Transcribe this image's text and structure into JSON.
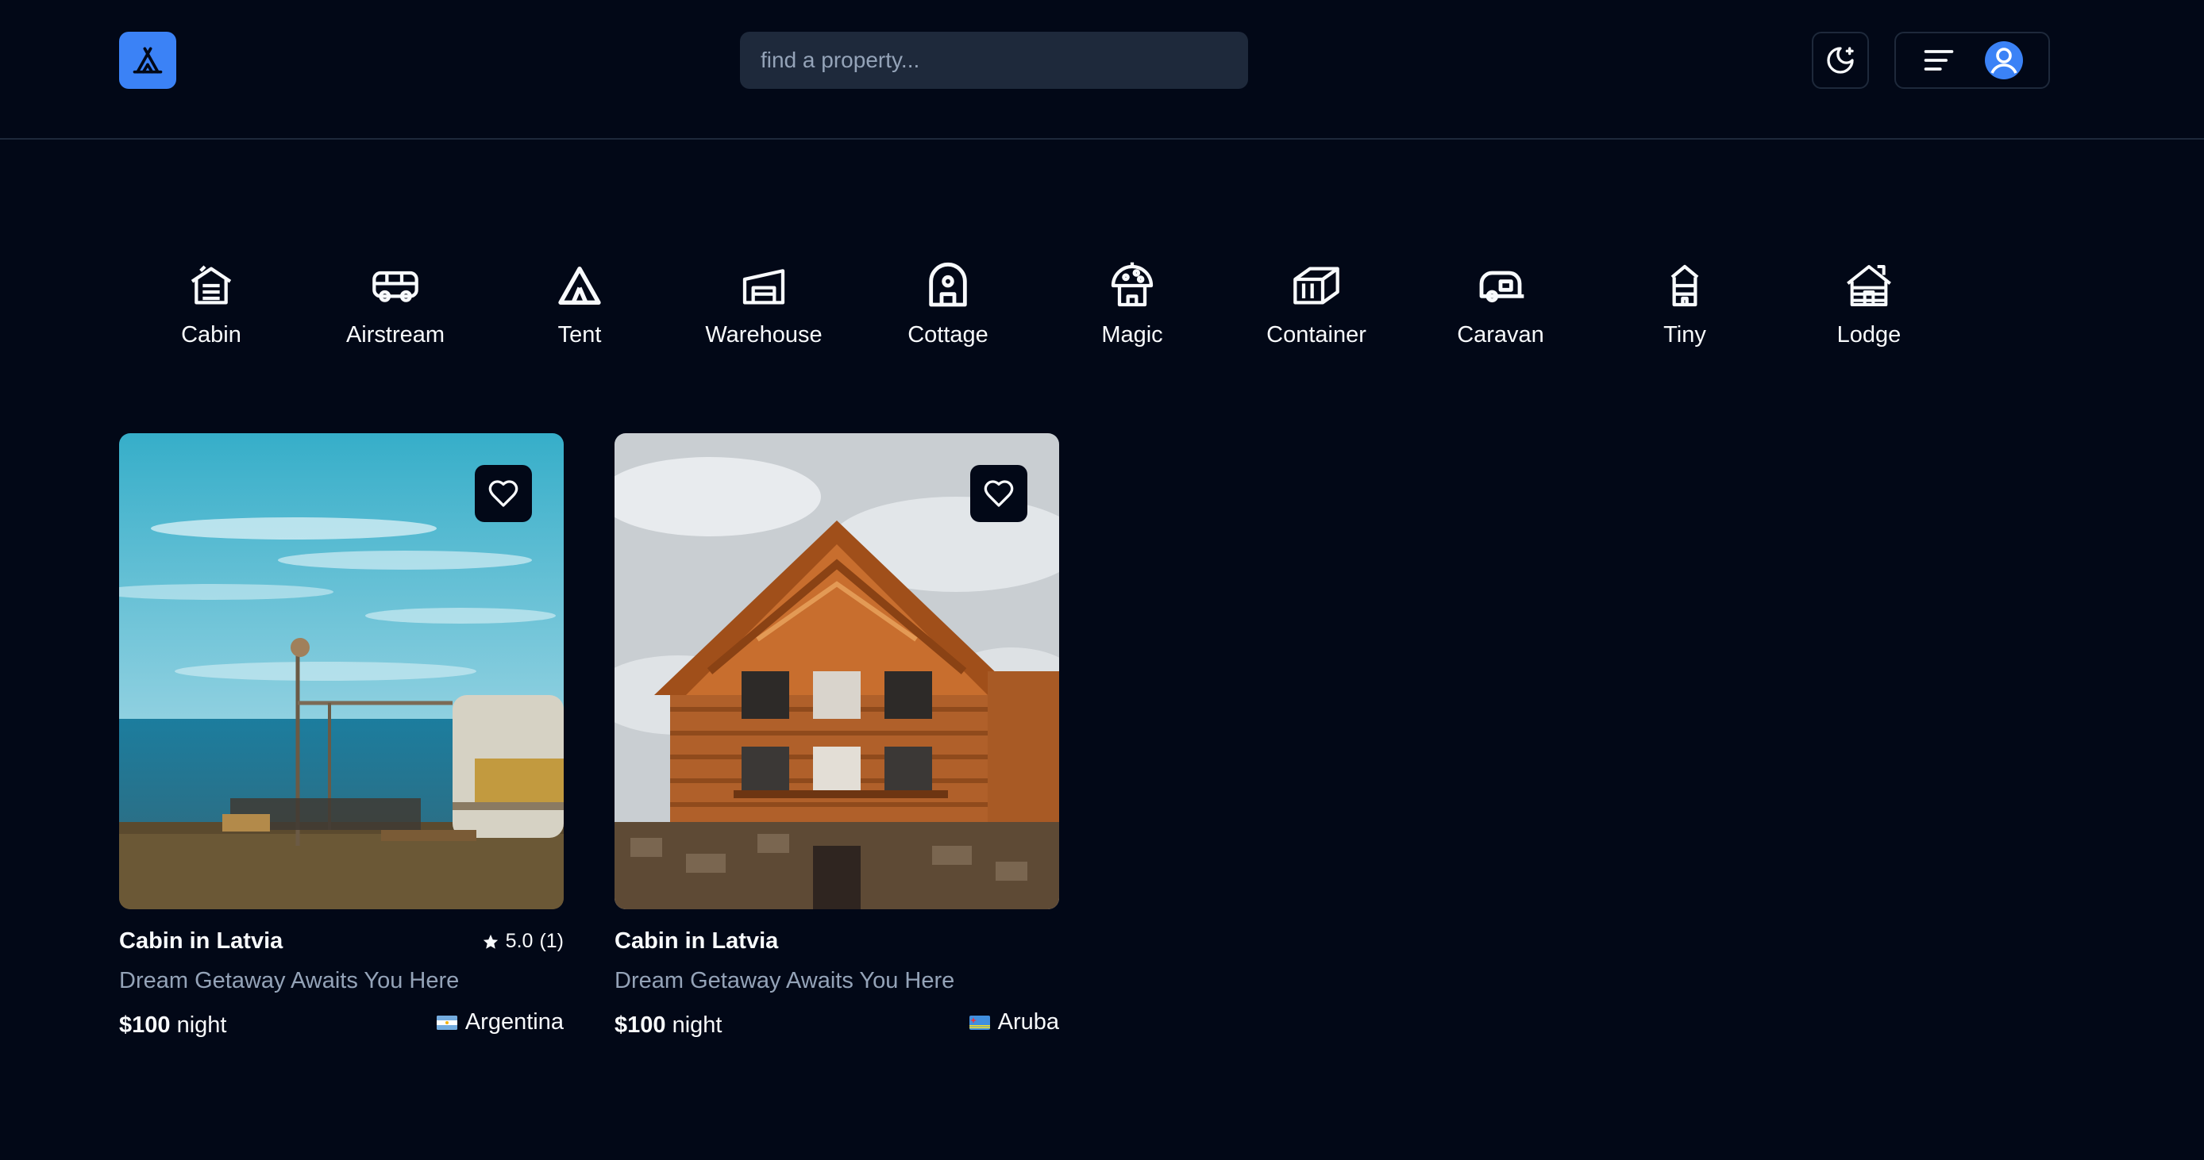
{
  "header": {
    "logo_icon": "tent-icon",
    "search_placeholder": "find a property...",
    "theme_icon": "moon-stars-icon",
    "menu_icon": "menu-lines-icon",
    "avatar_icon": "user-avatar-icon",
    "accent_color": "#3b82f6"
  },
  "categories": [
    {
      "label": "Cabin",
      "icon": "cabin-icon"
    },
    {
      "label": "Airstream",
      "icon": "airstream-icon"
    },
    {
      "label": "Tent",
      "icon": "tent-icon"
    },
    {
      "label": "Warehouse",
      "icon": "warehouse-icon"
    },
    {
      "label": "Cottage",
      "icon": "cottage-icon"
    },
    {
      "label": "Magic",
      "icon": "mushroom-house-icon"
    },
    {
      "label": "Container",
      "icon": "container-icon"
    },
    {
      "label": "Caravan",
      "icon": "caravan-icon"
    },
    {
      "label": "Tiny",
      "icon": "tiny-house-icon"
    },
    {
      "label": "Lodge",
      "icon": "lodge-icon"
    }
  ],
  "listings": [
    {
      "title": "Cabin in Latvia",
      "rating": "5.0",
      "reviews": "(1)",
      "tagline": "Dream Getaway Awaits You Here",
      "price": "$100",
      "price_unit": "night",
      "country": "Argentina",
      "image": "caravan by the sea"
    },
    {
      "title": "Cabin in Latvia",
      "tagline": "Dream Getaway Awaits You Here",
      "price": "$100",
      "price_unit": "night",
      "country": "Aruba",
      "image": "wooden log lodge"
    }
  ]
}
